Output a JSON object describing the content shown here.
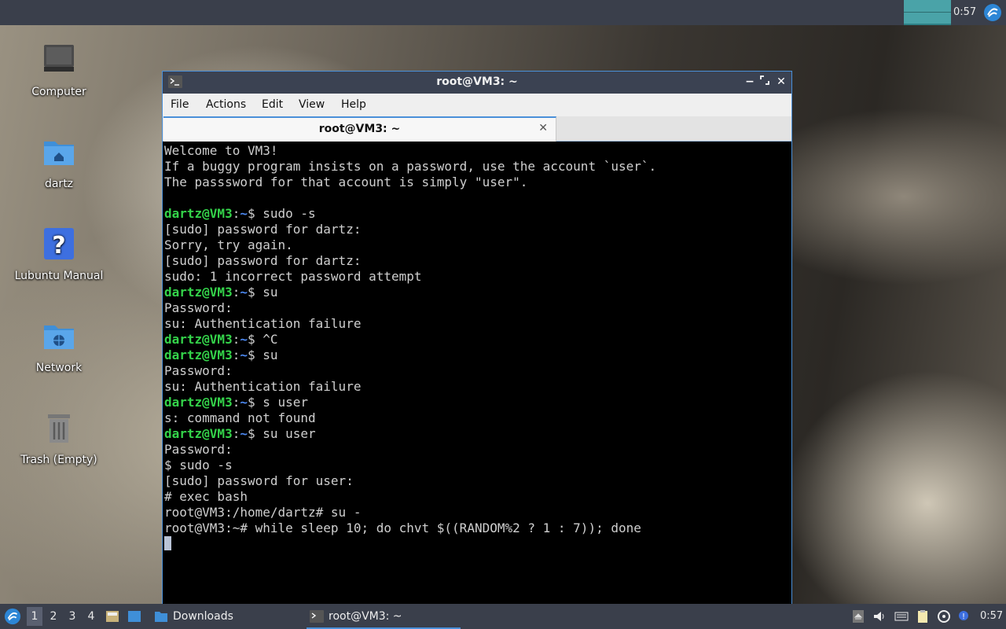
{
  "top_panel": {
    "clock": "0:57"
  },
  "desktop_icons": [
    {
      "label": "Computer",
      "icon": "computer-icon"
    },
    {
      "label": "dartz",
      "icon": "home-folder-icon"
    },
    {
      "label": "Lubuntu Manual",
      "icon": "help-icon"
    },
    {
      "label": "Network",
      "icon": "network-folder-icon"
    },
    {
      "label": "Trash (Empty)",
      "icon": "trash-icon"
    }
  ],
  "window": {
    "title": "root@VM3: ~",
    "menu": [
      "File",
      "Actions",
      "Edit",
      "View",
      "Help"
    ],
    "tab_title": "root@VM3: ~",
    "colors": {
      "prompt_user": "#34d34a",
      "prompt_path": "#4c88f0",
      "text": "#cfcfcf",
      "border": "#4a90d9"
    }
  },
  "terminal": {
    "lines": [
      {
        "text": "Welcome to VM3!"
      },
      {
        "text": "If a buggy program insists on a password, use the account `user`."
      },
      {
        "text": "The passsword for that account is simply \"user\"."
      },
      {
        "text": ""
      },
      {
        "user": "dartz@VM3",
        "path": "~",
        "text": "$ sudo -s"
      },
      {
        "text": "[sudo] password for dartz:"
      },
      {
        "text": "Sorry, try again."
      },
      {
        "text": "[sudo] password for dartz:"
      },
      {
        "text": "sudo: 1 incorrect password attempt"
      },
      {
        "user": "dartz@VM3",
        "path": "~",
        "text": "$ su"
      },
      {
        "text": "Password:"
      },
      {
        "text": "su: Authentication failure"
      },
      {
        "user": "dartz@VM3",
        "path": "~",
        "text": "$ ^C"
      },
      {
        "user": "dartz@VM3",
        "path": "~",
        "text": "$ su"
      },
      {
        "text": "Password:"
      },
      {
        "text": "su: Authentication failure"
      },
      {
        "user": "dartz@VM3",
        "path": "~",
        "text": "$ s user"
      },
      {
        "text": "s: command not found"
      },
      {
        "user": "dartz@VM3",
        "path": "~",
        "text": "$ su user"
      },
      {
        "text": "Password:"
      },
      {
        "text": "$ sudo -s"
      },
      {
        "text": "[sudo] password for user:"
      },
      {
        "text": "# exec bash"
      },
      {
        "text": "root@VM3:/home/dartz# su -"
      },
      {
        "text": "root@VM3:~# while sleep 10; do chvt $((RANDOM%2 ? 1 : 7)); done"
      }
    ]
  },
  "taskbar": {
    "workspaces": [
      "1",
      "2",
      "3",
      "4"
    ],
    "tasks": [
      {
        "label": "Downloads",
        "icon": "folder-icon"
      },
      {
        "label": "root@VM3: ~",
        "icon": "terminal-icon"
      }
    ],
    "clock": "0:57"
  }
}
